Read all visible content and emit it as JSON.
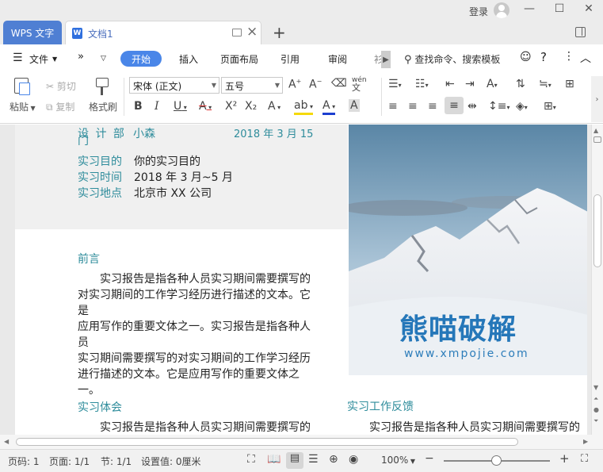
{
  "titlebar": {
    "app_tab": "WPS 文字",
    "doc_tab": "文档1",
    "doc_icon_glyph": "W",
    "login": "登录"
  },
  "menu": {
    "file": "文件",
    "items": [
      "开始",
      "插入",
      "页面布局",
      "引用",
      "审阅",
      "衫"
    ],
    "search": "查找命令、搜索模板"
  },
  "toolbar": {
    "paste": "粘贴",
    "cut": "剪切",
    "copy": "复制",
    "format_painter": "格式刷",
    "font_name": "宋体 (正文)",
    "font_size": "五号",
    "pinyin_glyph": "wén",
    "bold": "B",
    "italic": "I",
    "underline": "U",
    "strike": "A",
    "superscript": "X²",
    "subscript": "X₂",
    "text_effect": "A",
    "highlight": "ab",
    "font_color": "A",
    "char_shading": "A"
  },
  "document": {
    "header": {
      "dept_label": "设 计 部",
      "dept_suffix": "门",
      "name": "小森",
      "date": "2018 年 3 月 15",
      "fields": [
        {
          "label": "实习目的",
          "value": "你的实习目的"
        },
        {
          "label": "实习时间",
          "value": "2018 年 3 月~5 月"
        },
        {
          "label": "实习地点",
          "value": "北京市 XX 公司"
        }
      ]
    },
    "preface": {
      "heading": "前言",
      "lines": [
        "实习报告是指各种人员实习期间需要撰写的",
        "对实习期间的工作学习经历进行描述的文本。它是",
        "应用写作的重要文体之一。实习报告是指各种人员",
        "实习期间需要撰写的对实习期间的工作学习经历",
        "进行描述的文本。它是应用写作的重要文体之一。"
      ]
    },
    "experience": {
      "heading": "实习体会",
      "line": "实习报告是指各种人员实习期间需要撰写的"
    },
    "feedback": {
      "heading": "实习工作反馈",
      "line": "实习报告是指各种人员实习期间需要撰写的"
    },
    "watermark": {
      "title": "熊喵破解",
      "url": "www.xmpojie.com"
    }
  },
  "status": {
    "page_num": "页码: 1",
    "pages": "页面: 1/1",
    "section": "节: 1/1",
    "setting": "设置值: 0厘米",
    "zoom": "100%"
  },
  "colors": {
    "accent": "#4a86e8",
    "heading_teal": "#2e8c9b",
    "watermark_blue": "#2577b9"
  }
}
